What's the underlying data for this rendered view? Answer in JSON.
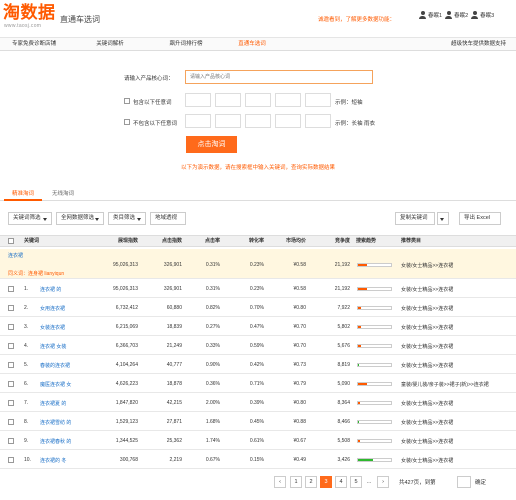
{
  "brand": {
    "logo_text": "淘数据",
    "logo_url": "www.taosj.com",
    "site_tag": "直通车选词"
  },
  "top_notice": "诚邀看到，了解更多数据功能：",
  "users": [
    {
      "name": "春眠1"
    },
    {
      "name": "春眠2"
    },
    {
      "name": "春眠3"
    }
  ],
  "nav": {
    "items": [
      {
        "label": "专家免费诊断店铺",
        "active": false
      },
      {
        "label": "关键词解析",
        "active": false
      },
      {
        "label": "飙升词排行榜",
        "active": false
      },
      {
        "label": "直通车选词",
        "active": true
      }
    ],
    "right_label": "超级快车提供数据支持"
  },
  "form": {
    "keyword_label": "请输入产品核心词：",
    "keyword_placeholder": "请输入产品核心词",
    "include_label": "包含以下任意词",
    "include_example": "示例：短袖",
    "exclude_label": "不包含以下任意词",
    "exclude_example": "示例：长袖 雨衣",
    "search_button": "点击淘词",
    "demo_note": "以下为演示数据，请在搜索框中输入关键词，查询实际数据结果"
  },
  "tabs": [
    {
      "label": "精准淘词",
      "active": true
    },
    {
      "label": "无线淘词",
      "active": false
    }
  ],
  "toolbar": {
    "filters": [
      "关键词筛选",
      "全网数据筛选",
      "类目筛选"
    ],
    "perspective": "地域透视",
    "copy_button": "复制关键词",
    "export_button": "导出 Excel"
  },
  "table": {
    "headers": [
      "关键词",
      "展现指数",
      "点击指数",
      "点击率",
      "转化率",
      "市场均价",
      "竞争度",
      "搜索趋势",
      "推荐类目"
    ],
    "parent": {
      "keyword": "连衣裙",
      "impressions": "95,026,313",
      "clicks": "326,901",
      "ctr": "0.31%",
      "cvr": "0.23%",
      "price": "¥0.58",
      "competition": "21,192",
      "category": "女装/女士精品>>连衣裙",
      "trend": 0.26,
      "trend_color": "#ff5a00",
      "similar_label": "同义词：连身裙 lianyiqun"
    },
    "rows": [
      {
        "no": "1.",
        "keyword": "连衣裙 的",
        "impressions": "95,026,313",
        "clicks": "326,901",
        "ctr": "0.31%",
        "cvr": "0.23%",
        "price": "¥0.58",
        "competition": "21,192",
        "category": "女装/女士精品>>连衣裙",
        "trend": 0.26,
        "trend_color": "#ff5a00"
      },
      {
        "no": "2.",
        "keyword": "女用连衣裙",
        "impressions": "6,732,412",
        "clicks": "60,880",
        "ctr": "0.82%",
        "cvr": "0.70%",
        "price": "¥0.80",
        "competition": "7,922",
        "category": "女装/女士精品>>连衣裙",
        "trend": 0.08,
        "trend_color": "#ff5a00"
      },
      {
        "no": "3.",
        "keyword": "女装连衣裙",
        "impressions": "6,215,069",
        "clicks": "18,839",
        "ctr": "0.27%",
        "cvr": "0.47%",
        "price": "¥0.70",
        "competition": "5,802",
        "category": "女装/女士精品>>连衣裙",
        "trend": 0.08,
        "trend_color": "#ff5a00"
      },
      {
        "no": "4.",
        "keyword": "连衣裙 女装",
        "impressions": "6,366,703",
        "clicks": "21,249",
        "ctr": "0.33%",
        "cvr": "0.59%",
        "price": "¥0.70",
        "competition": "5,676",
        "category": "女装/女士精品>>连衣裙",
        "trend": 0.08,
        "trend_color": "#ff5a00"
      },
      {
        "no": "5.",
        "keyword": "春装的连衣裙",
        "impressions": "4,104,264",
        "clicks": "40,777",
        "ctr": "0.90%",
        "cvr": "0.42%",
        "price": "¥0.73",
        "competition": "8,819",
        "category": "女装/女士精品>>连衣裙",
        "trend": 0.03,
        "trend_color": "#2eb82e"
      },
      {
        "no": "6.",
        "keyword": "魔医连衣裙 女",
        "impressions": "4,626,223",
        "clicks": "18,878",
        "ctr": "0.36%",
        "cvr": "0.71%",
        "price": "¥0.79",
        "competition": "5,090",
        "category": "童装/婴儿装/亲子装>>裙子(新)>>连衣裙",
        "trend": 0.26,
        "trend_color": "#ff5a00"
      },
      {
        "no": "7.",
        "keyword": "连衣裙夏 的",
        "impressions": "1,847,820",
        "clicks": "42,215",
        "ctr": "2.00%",
        "cvr": "0.39%",
        "price": "¥0.80",
        "competition": "8,364",
        "category": "女装/女士精品>>连衣裙",
        "trend": 0.05,
        "trend_color": "#ff5a00"
      },
      {
        "no": "8.",
        "keyword": "连衣裙雪纺 的",
        "impressions": "1,529,123",
        "clicks": "27,871",
        "ctr": "1.68%",
        "cvr": "0.45%",
        "price": "¥0.88",
        "competition": "8,466",
        "category": "女装/女士精品>>连衣裙",
        "trend": 0.03,
        "trend_color": "#2eb82e"
      },
      {
        "no": "9.",
        "keyword": "连衣裙春秋 的",
        "impressions": "1,344,525",
        "clicks": "25,362",
        "ctr": "1.74%",
        "cvr": "0.61%",
        "price": "¥0.67",
        "competition": "5,508",
        "category": "女装/女士精品>>连衣裙",
        "trend": 0.05,
        "trend_color": "#ff5a00"
      },
      {
        "no": "10.",
        "keyword": "连衣裙的 冬",
        "impressions": "300,768",
        "clicks": "2,219",
        "ctr": "0.67%",
        "cvr": "0.15%",
        "price": "¥0.49",
        "competition": "3,426",
        "category": "女装/女士精品>>连衣裙",
        "trend": 0.45,
        "trend_color": "#2eb82e"
      }
    ]
  },
  "pagination": {
    "prev": "‹",
    "pages": [
      "1",
      "2",
      "3",
      "4",
      "5"
    ],
    "current": "3",
    "ellipsis": "…",
    "next": "›",
    "info": "共427页，到第",
    "go": "确定"
  }
}
